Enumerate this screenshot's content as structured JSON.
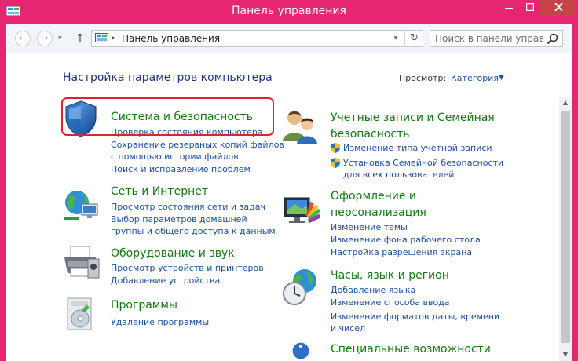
{
  "window": {
    "title": "Панель управления",
    "min_icon": "minimize-icon",
    "max_icon": "maximize-icon",
    "close_icon": "close-icon"
  },
  "nav": {
    "back_glyph": "←",
    "fwd_glyph": "→",
    "drop_glyph": "▾",
    "up_glyph": "↑",
    "address_sep": "▸",
    "address_text": "Панель управления",
    "address_dd": "▾",
    "refresh_glyph": "↻",
    "search_placeholder": "Поиск в панели управ"
  },
  "header": {
    "title": "Настройка параметров компьютера",
    "view_label": "Просмотр:",
    "view_value": "Категория",
    "view_arrow": "▼"
  },
  "categories": {
    "system": {
      "title": "Система и безопасность",
      "links": [
        "Проверка состояния компьютера",
        "Сохранение резервных копий файлов",
        "с помощью истории файлов",
        "Поиск и исправление проблем"
      ]
    },
    "network": {
      "title": "Сеть и Интернет",
      "links": [
        "Просмотр состояния сети и задач",
        "Выбор параметров домашней",
        "группы и общего доступа к данным"
      ]
    },
    "hardware": {
      "title": "Оборудование и звук",
      "links": [
        "Просмотр устройств и принтеров",
        "Добавление устройства"
      ]
    },
    "programs": {
      "title": "Программы",
      "links": [
        "Удаление программы"
      ]
    },
    "users": {
      "title_line1": "Учетные записи и Семейная",
      "title_line2": "безопасность",
      "links": [
        "Изменение типа учетной записи",
        "Установка Семейной безопасности",
        "для всех пользователей"
      ]
    },
    "appearance": {
      "title_line1": "Оформление и",
      "title_line2": "персонализация",
      "links": [
        "Изменение темы",
        "Изменение фона рабочего стола",
        "Настройка разрешения экрана"
      ]
    },
    "clock": {
      "title": "Часы, язык и регион",
      "links": [
        "Добавление языка",
        "Изменение способа ввода",
        "Изменение форматов даты, времени",
        "и чисел"
      ]
    },
    "access": {
      "title": "Специальные возможности"
    }
  },
  "colors": {
    "accent": "#e6266e",
    "category_title": "#107c10",
    "link": "#1e50a2",
    "highlight": "#d8262c"
  }
}
